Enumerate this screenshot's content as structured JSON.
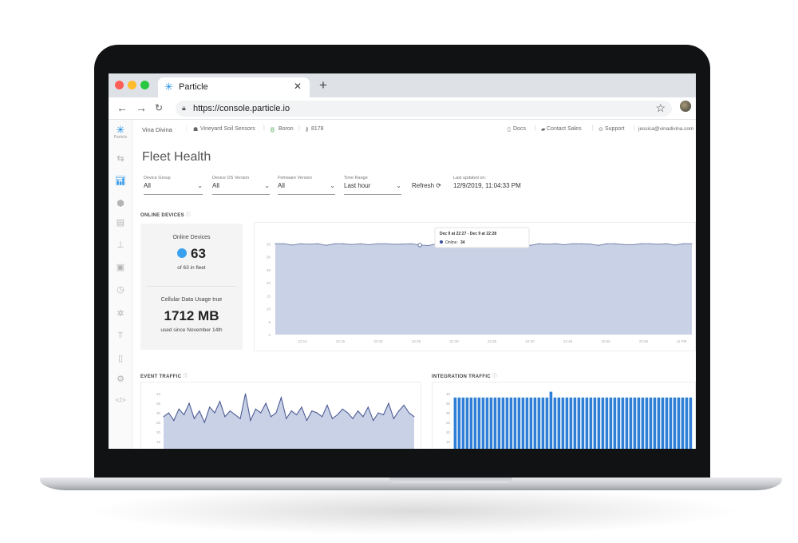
{
  "browser": {
    "tab_title": "Particle",
    "url": "https://console.particle.io",
    "icons": [
      "particle-logo-icon",
      "close-icon",
      "plus-icon",
      "back-arrow-icon",
      "forward-arrow-icon",
      "reload-icon",
      "lock-icon",
      "star-icon",
      "kebab-menu-icon"
    ]
  },
  "sidebar": {
    "brand_label": "Particle",
    "items": [
      {
        "icon": "devices-icon",
        "active": false
      },
      {
        "icon": "fleet-health-icon",
        "active": true
      },
      {
        "icon": "cube-icon",
        "active": false
      },
      {
        "icon": "document-icon",
        "active": false
      },
      {
        "icon": "flask-icon",
        "active": false
      },
      {
        "icon": "sim-card-icon",
        "active": false
      },
      {
        "icon": "clock-icon",
        "active": false
      },
      {
        "icon": "network-icon",
        "active": false
      },
      {
        "icon": "analytics-icon",
        "active": false
      },
      {
        "icon": "trash-icon",
        "active": false
      },
      {
        "icon": "settings-icon",
        "active": false
      },
      {
        "icon": "code-icon",
        "active": false
      }
    ]
  },
  "topnav": {
    "org": "Vina Divina",
    "product": "Vineyard Soil Sensors",
    "platform": "Boron",
    "product_id": "8178",
    "docs": "Docs",
    "contact_sales": "Contact Sales",
    "support": "Support",
    "user_email": "jessica@vinadivina.com"
  },
  "page": {
    "title": "Fleet Health"
  },
  "filters": {
    "device_group": {
      "label": "Device Group",
      "value": "All"
    },
    "device_os": {
      "label": "Device OS Version",
      "value": "All"
    },
    "firmware": {
      "label": "Firmware Version",
      "value": "All"
    },
    "time_range": {
      "label": "Time Range",
      "value": "Last hour"
    },
    "refresh_label": "Refresh",
    "last_updated_label": "Last updated on:",
    "last_updated_value": "12/9/2019, 11:04:33 PM"
  },
  "online_devices": {
    "section_label": "ONLINE DEVICES",
    "card_title": "Online Devices",
    "count": "63",
    "fleet_text": "of 63 in fleet",
    "data_usage_title": "Cellular Data Usage true",
    "data_usage_value": "1712 MB",
    "data_usage_since": "used since November 14th",
    "status_color": "#3aa1ee"
  },
  "tooltip": {
    "range": "Dec 9 at 22:27 - Dec 9 at 22:28",
    "series": "Online:",
    "value": "34"
  },
  "event_traffic": {
    "section_label": "EVENT TRAFFIC"
  },
  "integration_traffic": {
    "section_label": "INTEGRATION TRAFFIC"
  },
  "chart_data": [
    {
      "type": "area",
      "name": "online-devices",
      "ylim": [
        0,
        40
      ],
      "y_ticks": [
        "0",
        "5",
        "10",
        "15",
        "20",
        "25",
        "30",
        "35"
      ],
      "x_ticks": [
        "22:10",
        "22:15",
        "22:20",
        "22:25",
        "22:30",
        "22:35",
        "22:40",
        "22:45",
        "22:50",
        "22:55",
        "11 PM"
      ],
      "values": [
        35,
        35,
        34.5,
        35,
        34.8,
        35,
        34.4,
        35,
        35,
        34.7,
        35,
        34.6,
        35,
        35,
        34.8,
        34.9,
        35,
        34.5,
        34.3,
        35,
        34.8,
        35,
        35,
        34.6,
        35,
        34.9,
        35,
        34.7,
        35,
        35,
        34.4,
        35,
        34.8,
        35,
        34.6,
        35,
        35,
        34.9,
        34.4,
        35,
        35,
        34.7,
        34.6,
        35,
        35,
        34.8,
        35,
        34.5,
        35,
        35
      ],
      "series_color": "#c9d1e6",
      "line_color": "#7985ab"
    },
    {
      "type": "area",
      "name": "event-traffic",
      "ylim": [
        0,
        45
      ],
      "y_ticks": [
        "10",
        "15",
        "20",
        "25",
        "30",
        "35",
        "40"
      ],
      "values": [
        28,
        30,
        26,
        32,
        29,
        35,
        27,
        31,
        25,
        33,
        30,
        36,
        28,
        31,
        29,
        27,
        40,
        26,
        32,
        30,
        35,
        28,
        30,
        38,
        27,
        31,
        29,
        33,
        26,
        31,
        30,
        28,
        34,
        27,
        29,
        32,
        30,
        27,
        31,
        28,
        33,
        26,
        30,
        29,
        35,
        27,
        31,
        34,
        30,
        28
      ],
      "series_color": "#c9d1e6",
      "line_color": "#4c5c94"
    },
    {
      "type": "bar",
      "name": "integration-traffic",
      "ylim": [
        0,
        45
      ],
      "y_ticks": [
        "10",
        "15",
        "20",
        "25",
        "30",
        "35",
        "40"
      ],
      "values": [
        38,
        38,
        38,
        38,
        38,
        38,
        38,
        38,
        38,
        38,
        38,
        38,
        38,
        38,
        38,
        38,
        38,
        38,
        38,
        38,
        38,
        38,
        38,
        38,
        41,
        38,
        38,
        38,
        38,
        38,
        38,
        38,
        38,
        38,
        38,
        38,
        38,
        38,
        38,
        38,
        38,
        38,
        38,
        38,
        38,
        38,
        38,
        38,
        38,
        38,
        38,
        38,
        38,
        38,
        38,
        38,
        38,
        38,
        38,
        38
      ],
      "series_color": "#2f7fd6"
    }
  ]
}
